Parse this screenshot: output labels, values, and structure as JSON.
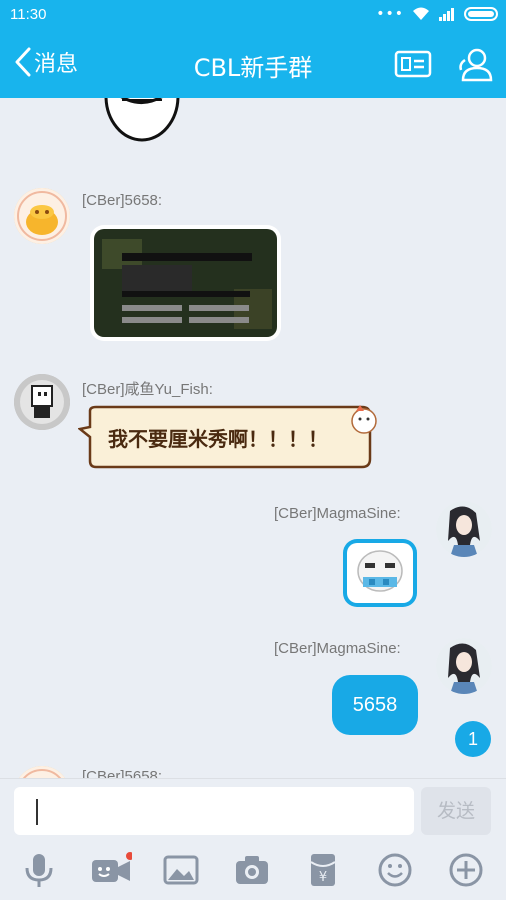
{
  "status_bar": {
    "time": "11:30"
  },
  "header": {
    "back_label": "消息",
    "title": "CBL新手群"
  },
  "messages": [
    {
      "sender": "[CBer]5658:"
    },
    {
      "sender": "[CBer]咸鱼Yu_Fish:",
      "sticker_text": "我不要厘米秀啊！！！！"
    },
    {
      "sender": "[CBer]MagmaSine:"
    },
    {
      "sender": "[CBer]MagmaSine:",
      "text": "5658"
    },
    {
      "sender": "[CBer]5658:"
    }
  ],
  "unread_count": "1",
  "input": {
    "send_label": "发送"
  },
  "colors": {
    "accent": "#18b4ed",
    "bubble": "#18a9e6",
    "background": "#eaeef4"
  }
}
